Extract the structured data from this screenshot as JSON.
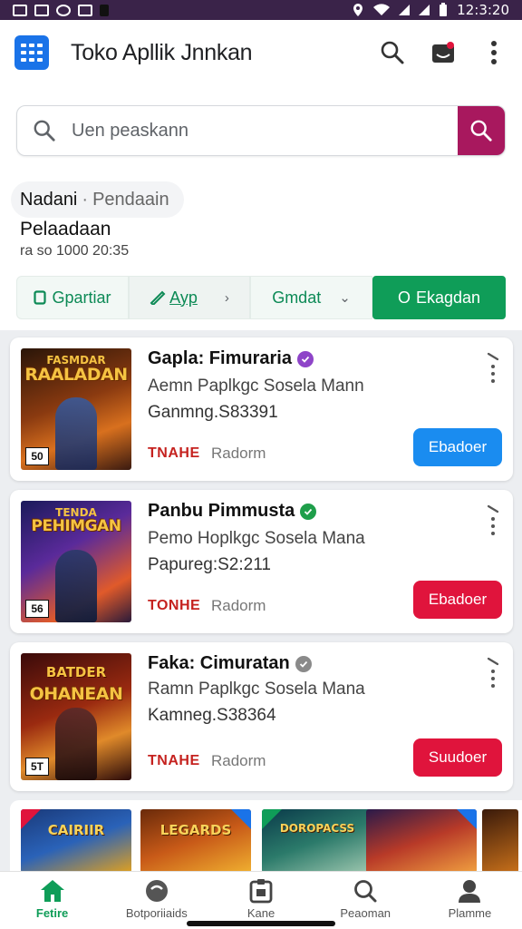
{
  "status_bar": {
    "time": "12:3:20",
    "left_icons": [
      "notification-icon",
      "mail-icon",
      "sync-icon",
      "mail-icon",
      "battery-saver-icon"
    ],
    "right_icons": [
      "location-icon",
      "wifi-icon",
      "signal-icon",
      "signal-icon"
    ]
  },
  "app_bar": {
    "title": "Toko Apllik Jnnkan",
    "logo_color": "#1a73e8"
  },
  "search": {
    "placeholder": "Uen peaskann",
    "button_color": "#a8185e"
  },
  "breadcrumb": {
    "main": "Nadani",
    "separator": "·",
    "sub": "Pendaain"
  },
  "section": {
    "title": "Pelaadaan",
    "meta": "ra so 1000 20:35"
  },
  "filters": {
    "chip1": "Gpartiar",
    "chip2": "Ayp",
    "chip3": "Gmdat",
    "chip4": "Ekagdan",
    "chip4_prefix": "O"
  },
  "cards": [
    {
      "cover_title": "RAALADAN",
      "cover_subtitle": "FASMDAR",
      "cover_badge": "50",
      "name": "Gapla: Fimuraria",
      "verified_color": "#8e44c8",
      "desc": "Aemn Paplkgc Sosela Mann",
      "stat": "Ganmng.S83391",
      "tag": "TNAHE",
      "sub": "Radorm",
      "button": "Ebadoer",
      "button_color": "#1a8cf0"
    },
    {
      "cover_title": "PEHIMGAN",
      "cover_subtitle": "TENDA",
      "cover_badge": "56",
      "name": "Panbu Pimmusta",
      "verified_color": "#1e9e4a",
      "desc": "Pemo Hoplkgc Sosela Mana",
      "stat": "Papureg:S2:211",
      "tag": "TONHE",
      "sub": "Radorm",
      "button": "Ebadoer",
      "button_color": "#e0143c"
    },
    {
      "cover_title": "OHANEAN",
      "cover_subtitle": "BATDER",
      "cover_badge": "5T",
      "name": "Faka: Cimuratan",
      "verified_color": "#8a8a8a",
      "desc": "Ramn Paplkgc Sosela Mana",
      "stat": "Kamneg.S38364",
      "tag": "TNAHE",
      "sub": "Radorm",
      "button": "Suudoer",
      "button_color": "#e0143c"
    }
  ],
  "strip": [
    {
      "label": "CAIRIIR",
      "color": "#2a62b8"
    },
    {
      "label": "LEGARDS",
      "color": "#c85a18"
    },
    {
      "label": "DOROPACSS",
      "color": "#2b7a6a"
    },
    {
      "label": "",
      "color": "#b83a28"
    },
    {
      "label": "",
      "color": "#c8701a"
    }
  ],
  "bottom_nav": [
    {
      "label": "Fetire",
      "icon": "home-icon"
    },
    {
      "label": "Botporiiaids",
      "icon": "games-icon"
    },
    {
      "label": "Kane",
      "icon": "apps-icon"
    },
    {
      "label": "Peaoman",
      "icon": "search-icon"
    },
    {
      "label": "Plamme",
      "icon": "profile-icon"
    }
  ]
}
